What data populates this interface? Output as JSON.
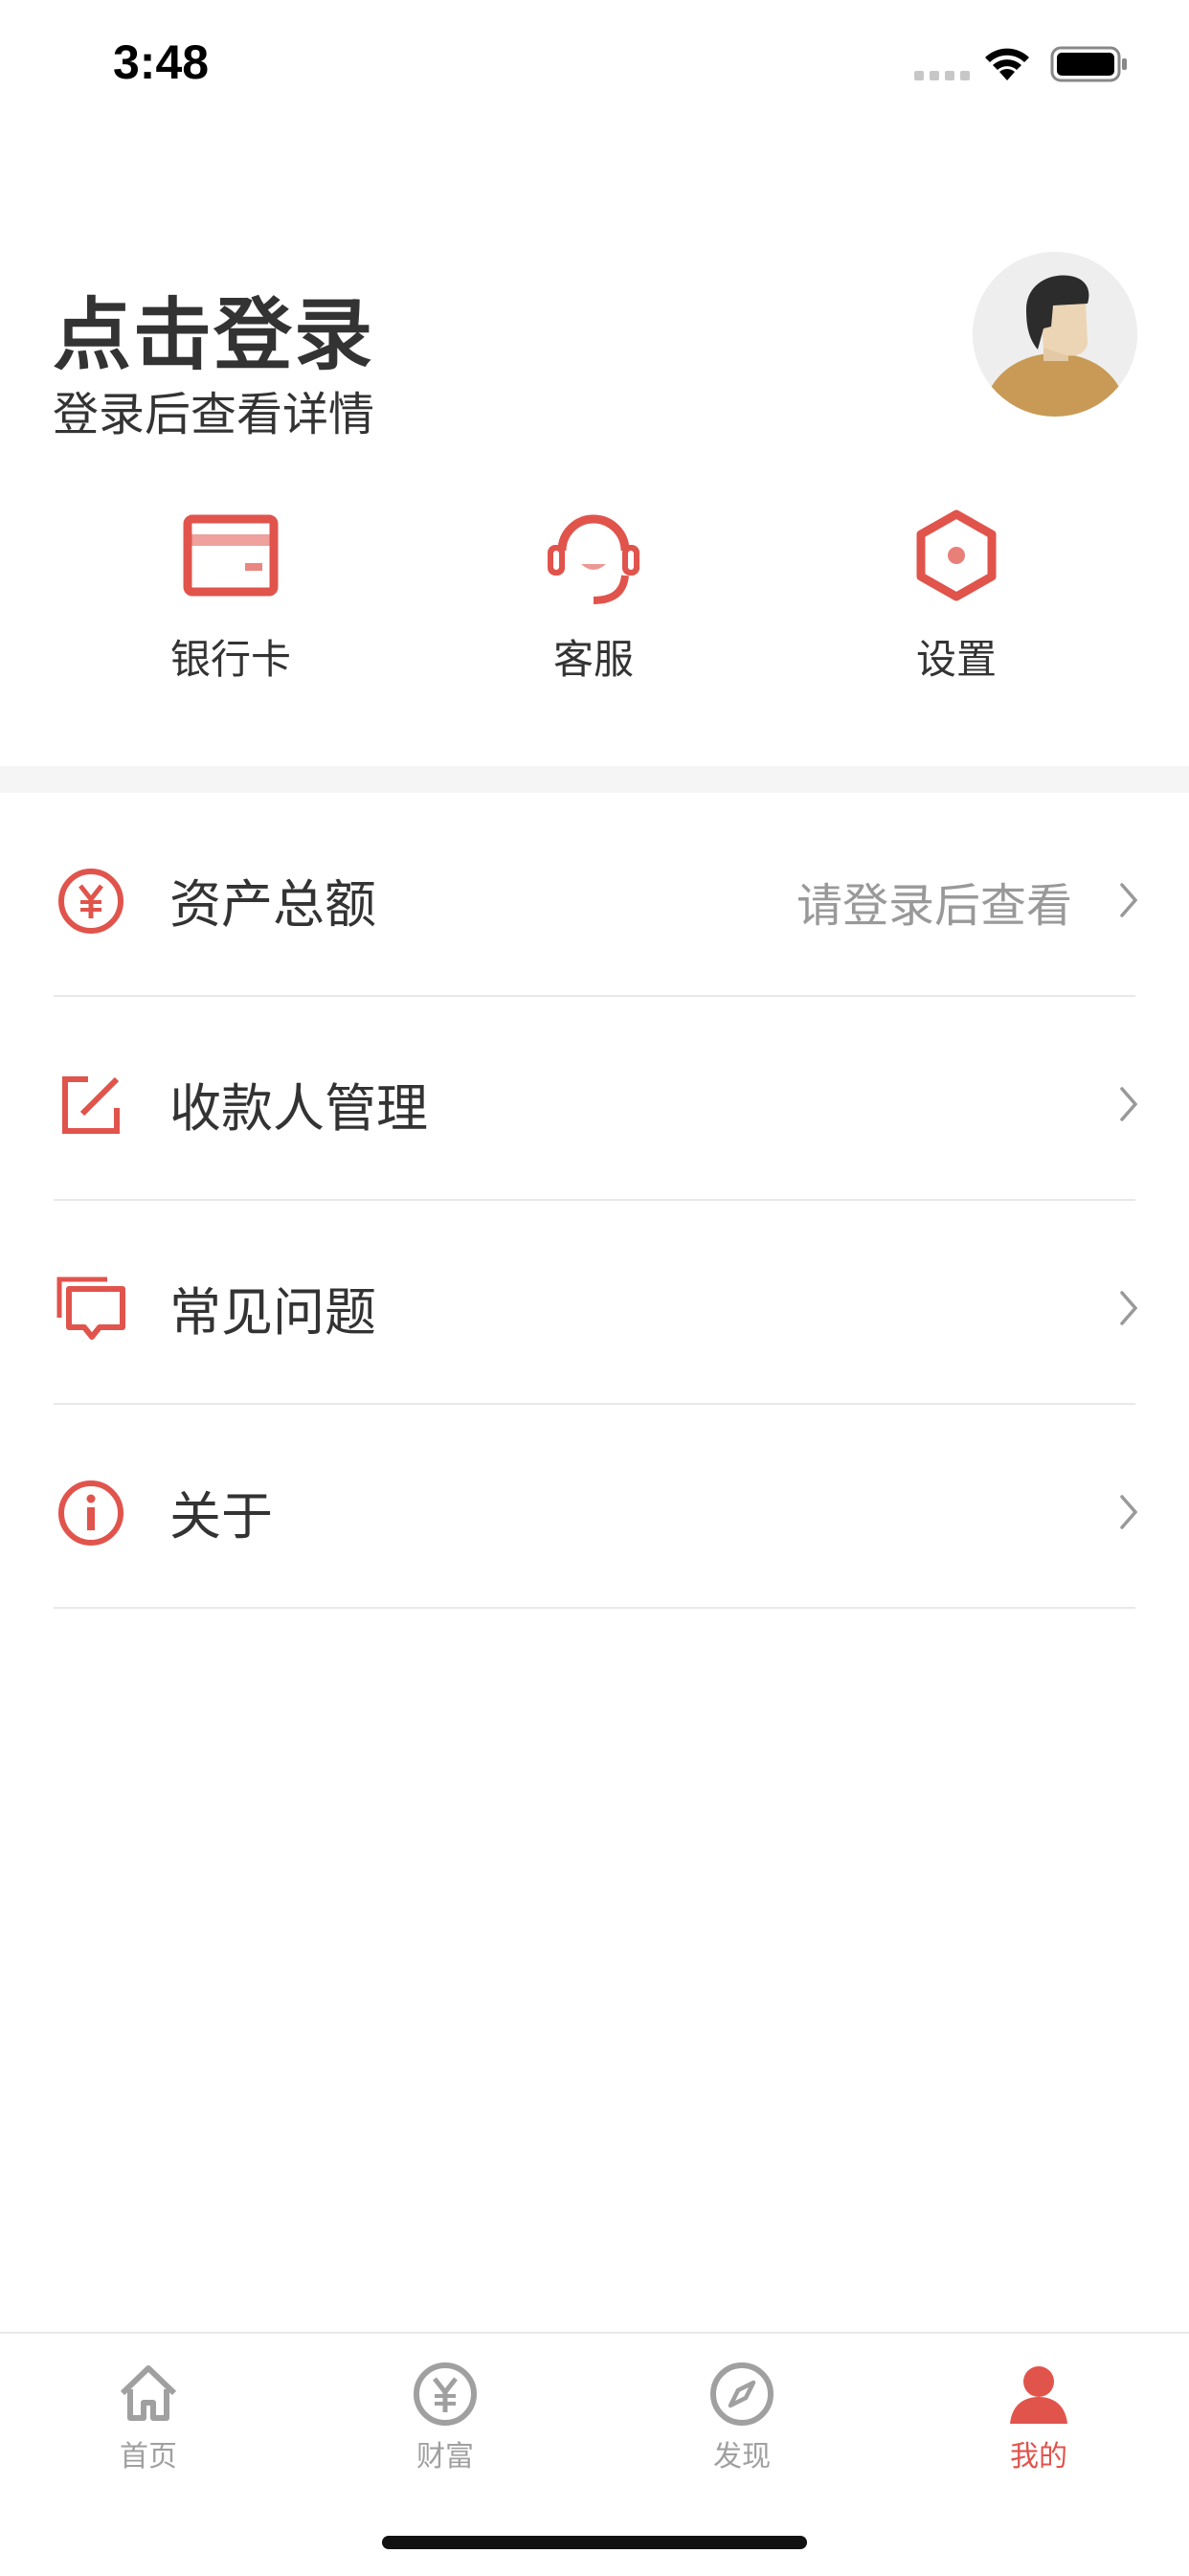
{
  "status_bar": {
    "time": "3:48"
  },
  "profile": {
    "title": "点击登录",
    "subtitle": "登录后查看详情",
    "avatar_icon": "user-avatar-illustration"
  },
  "quick_actions": [
    {
      "label": "银行卡",
      "icon": "bank-card-icon"
    },
    {
      "label": "客服",
      "icon": "headset-icon"
    },
    {
      "label": "设置",
      "icon": "hexagon-settings-icon"
    }
  ],
  "menu": [
    {
      "label": "资产总额",
      "value": "请登录后查看",
      "icon": "yen-circle-icon"
    },
    {
      "label": "收款人管理",
      "value": "",
      "icon": "edit-square-icon"
    },
    {
      "label": "常见问题",
      "value": "",
      "icon": "chat-bubbles-icon"
    },
    {
      "label": "关于",
      "value": "",
      "icon": "info-circle-icon"
    }
  ],
  "tab_bar": {
    "items": [
      {
        "label": "首页",
        "icon": "home-icon",
        "active": false
      },
      {
        "label": "财富",
        "icon": "yen-circle-icon",
        "active": false
      },
      {
        "label": "发现",
        "icon": "compass-icon",
        "active": false
      },
      {
        "label": "我的",
        "icon": "person-icon",
        "active": true
      }
    ]
  },
  "colors": {
    "accent": "#e0544c",
    "text": "#333333",
    "muted": "#999999",
    "tab_inactive": "#a0a0a0"
  }
}
